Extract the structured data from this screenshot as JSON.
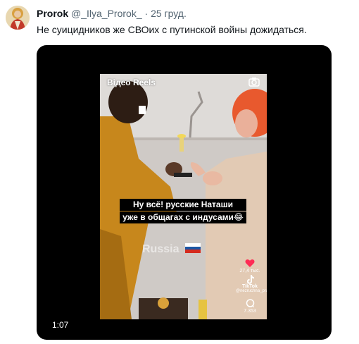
{
  "tweet": {
    "author_name": "Prorok",
    "author_handle": "@_Ilya_Prorok_",
    "separator": "·",
    "date": "25 груд.",
    "text": "Не суицидников же СВОих с путинской войны дожидаться."
  },
  "video": {
    "reels_label": "Відео Reels",
    "caption_line1": "Ну всё! русские Наташи",
    "caption_line2": "уже в общагах с индусами😂",
    "watermark": "Russia",
    "like_count": "27,4 тыс.",
    "tiktok_label": "TikTok",
    "tiktok_user": "@nezruchna_pravda",
    "comment_count": "7.353",
    "duration": "1:07"
  },
  "icons": [
    "avatar-icon",
    "camera-icon",
    "russia-flag-icon",
    "heart-icon",
    "tiktok-icon",
    "comment-icon"
  ],
  "colors": {
    "heart": "#fe2c55",
    "flag_white": "#ffffff",
    "flag_blue": "#1c57a5",
    "flag_red": "#d52b1e"
  }
}
